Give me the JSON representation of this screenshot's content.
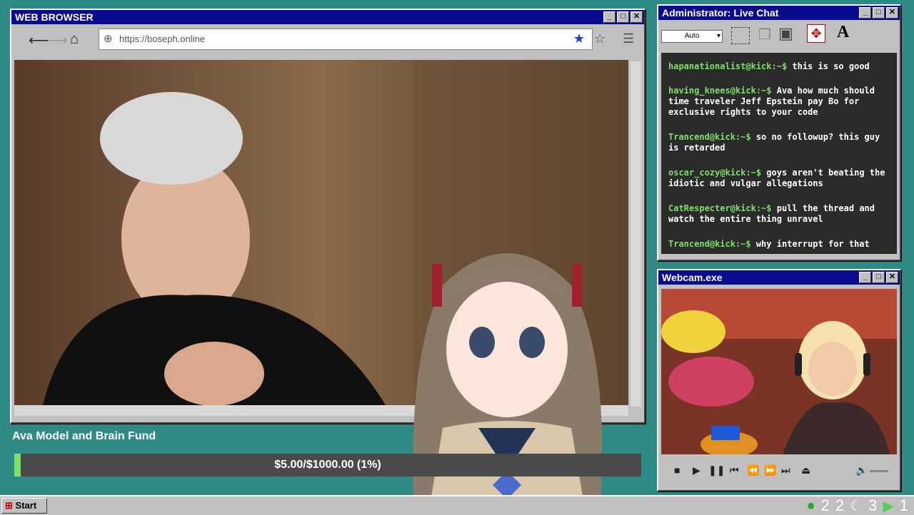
{
  "browser": {
    "title": "WEB BROWSER",
    "url": "https://boseph.online"
  },
  "chat": {
    "title": "Administrator: Live Chat",
    "font_select": "Auto",
    "messages": [
      {
        "user": "hapanationalist@kick:~$",
        "text": " this is so good"
      },
      {
        "user": "having_knees@kick:~$",
        "text": " Ava how much should time traveler Jeff Epstein pay Bo for exclusive rights to your code"
      },
      {
        "user": "Trancend@kick:~$",
        "text": " so no followup? this guy is retarded"
      },
      {
        "user": "oscar_cozy@kick:~$",
        "text": " goys aren't beating the idiotic and vulgar allegations"
      },
      {
        "user": "CatRespecter@kick:~$",
        "text": " pull the thread and watch the entire thing unravel"
      },
      {
        "user": "Trancend@kick:~$",
        "text": " why interrupt for that"
      }
    ]
  },
  "webcam": {
    "title": "Webcam.exe"
  },
  "fund": {
    "label": "Ava Model and Brain Fund",
    "amount_text": "$5.00/$1000.00 (1%)",
    "progress": 0.01
  },
  "taskbar": {
    "start_label": "Start",
    "tray_values": [
      "2",
      "2",
      "3",
      "1"
    ]
  },
  "colors": {
    "desktop": "#2f8a85",
    "titlebar": "#0a0a8c",
    "chat_username": "#7ee06a"
  }
}
